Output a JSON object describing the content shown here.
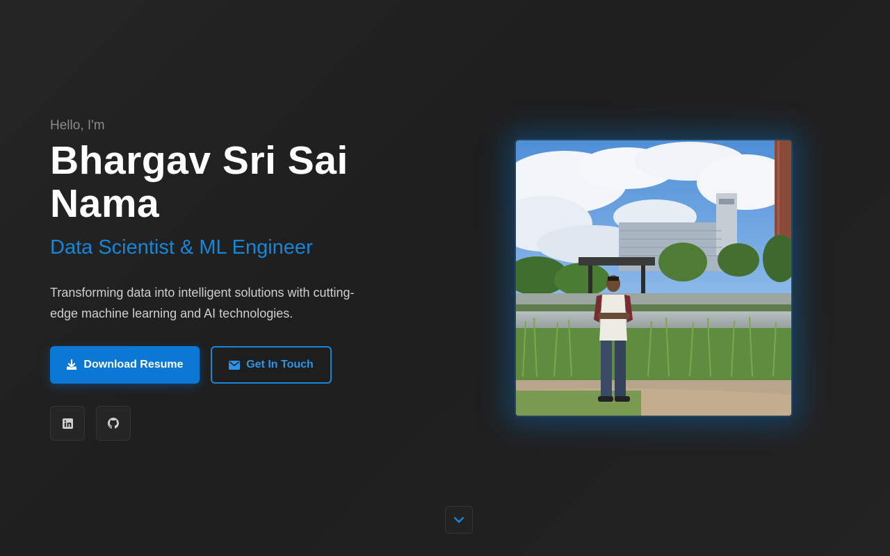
{
  "hero": {
    "greeting": "Hello, I'm",
    "name": "Bhargav Sri Sai Nama",
    "role": "Data Scientist & ML Engineer",
    "tagline": "Transforming data into intelligent solutions with cutting-edge machine learning and AI technologies."
  },
  "actions": {
    "download_label": "Download Resume",
    "contact_label": "Get In Touch"
  },
  "socials": {
    "linkedin_icon": "linkedin-icon",
    "github_icon": "github-icon"
  },
  "photo": {
    "icon": "profile-photo"
  },
  "scroll": {
    "icon": "chevron-down-icon"
  },
  "colors": {
    "accent": "#0a78d4",
    "accent_text": "#1786d8",
    "background": "#1f1f1f"
  }
}
